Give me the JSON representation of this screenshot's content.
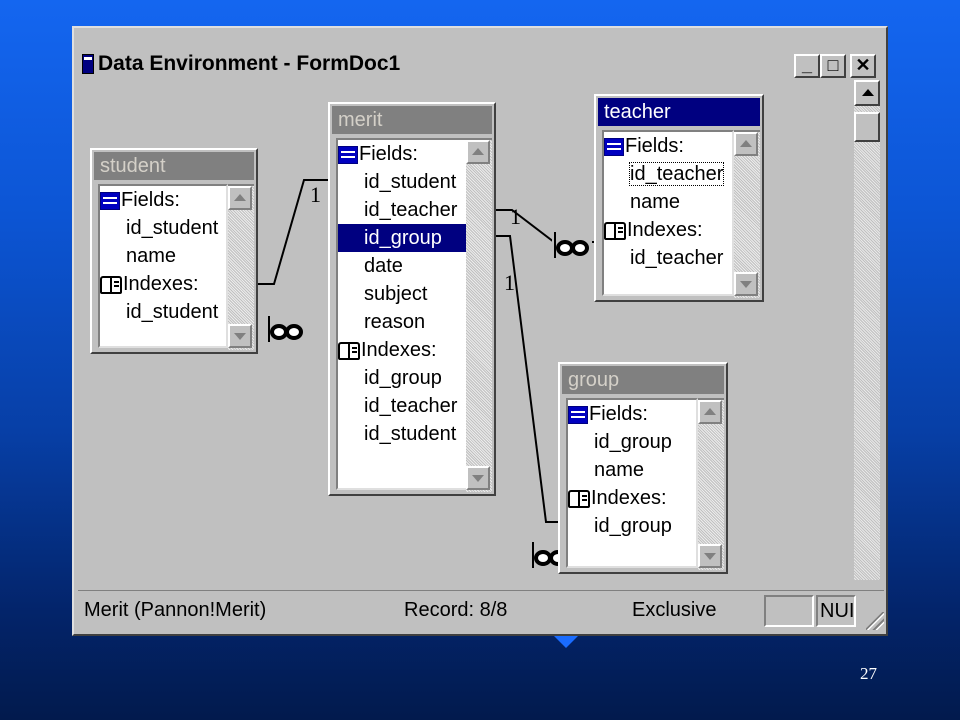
{
  "window": {
    "title": "Data Environment - FormDoc1",
    "buttons": {
      "minimize": "_",
      "maximize": "□",
      "close": "✕"
    }
  },
  "tables": {
    "student": {
      "title": "student",
      "rows": [
        "Fields:",
        "id_student",
        "name",
        "Indexes:",
        "id_student"
      ]
    },
    "merit": {
      "title": "merit",
      "rows": [
        "Fields:",
        "id_student",
        "id_teacher",
        "id_group",
        "date",
        "subject",
        "reason",
        "Indexes:",
        "id_group",
        "id_teacher",
        "id_student"
      ],
      "selected": "id_group"
    },
    "teacher": {
      "title": "teacher",
      "rows": [
        "Fields:",
        "id_teacher",
        "name",
        "Indexes:",
        "id_teacher"
      ],
      "focused": "id_teacher"
    },
    "group": {
      "title": "group",
      "rows": [
        "Fields:",
        "id_group",
        "name",
        "Indexes:",
        "id_group"
      ]
    }
  },
  "relations": {
    "one_labels": [
      "1",
      "1",
      "1"
    ]
  },
  "status": {
    "left": "Merit (Pannon!Merit)",
    "record": "Record: 8/8",
    "mode": "Exclusive",
    "box1": "",
    "box2": "NUI"
  },
  "slide": {
    "page_number": "27"
  },
  "colors": {
    "active_title": "#000080",
    "inactive_title": "#808080",
    "window_face": "#c0c0c0"
  }
}
